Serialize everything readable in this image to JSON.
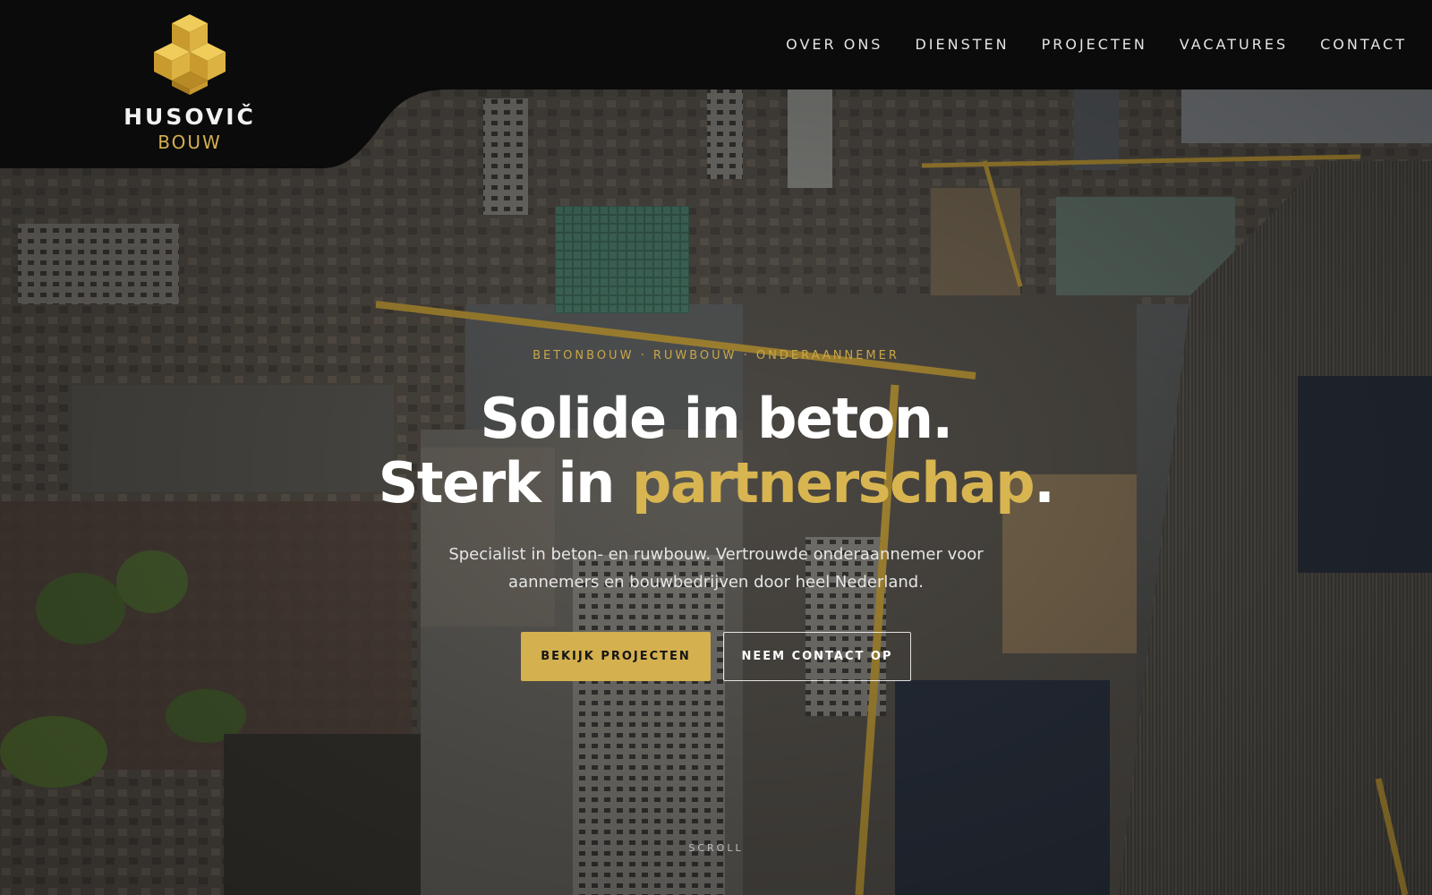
{
  "brand": {
    "name": "HUSOVIČ",
    "sub": "BOUW",
    "logo_icon": "gold-cubes-icon",
    "gold": "#d4af4f"
  },
  "nav": {
    "items": [
      {
        "label": "OVER ONS"
      },
      {
        "label": "DIENSTEN"
      },
      {
        "label": "PROJECTEN"
      },
      {
        "label": "VACATURES"
      },
      {
        "label": "CONTACT"
      }
    ]
  },
  "hero": {
    "eyebrow": "BETONBOUW · RUWBOUW · ONDERAANNEMER",
    "headline_line1": "Solide in beton.",
    "headline_line2_prefix": "Sterk in ",
    "headline_line2_accent": "partnerschap",
    "headline_line2_suffix": ".",
    "subtext_line1": "Specialist in beton- en ruwbouw. Vertrouwde onderaannemer voor",
    "subtext_line2": "aannemers en bouwbedrijven door heel Nederland.",
    "primary_button": "BEKIJK PROJECTEN",
    "secondary_button": "NEEM CONTACT OP",
    "scroll_label": "SCROLL",
    "background": "aerial-construction-city-photo"
  },
  "colors": {
    "accent": "#d4b04f",
    "header_bg": "#0b0b0b"
  }
}
